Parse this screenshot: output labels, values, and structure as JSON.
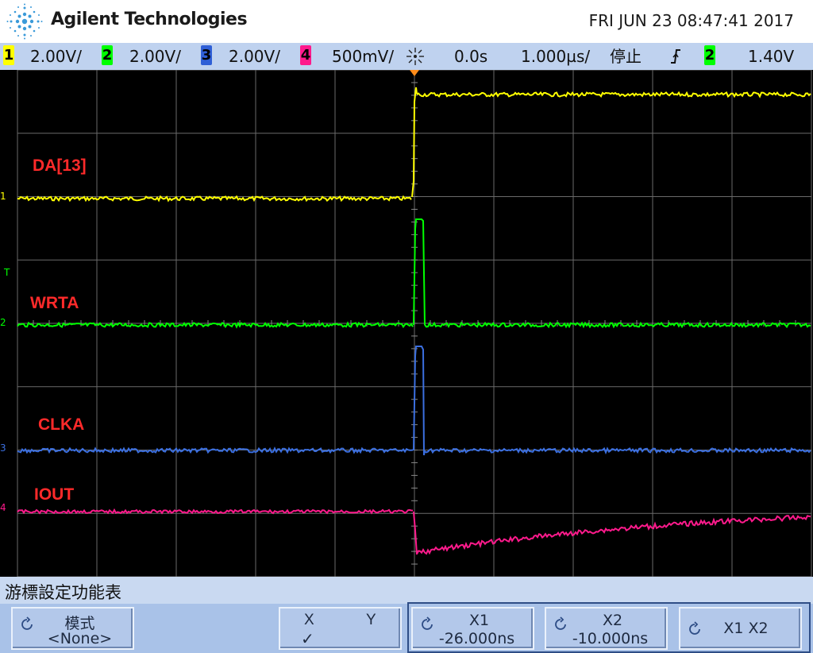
{
  "header": {
    "brand": "Agilent Technologies",
    "datetime": "FRI JUN 23 08:47:41 2017"
  },
  "statusbar": {
    "ch1": {
      "num": "1",
      "scale": "2.00V/",
      "color": "#ffff00"
    },
    "ch2": {
      "num": "2",
      "scale": "2.00V/",
      "color": "#00ff00"
    },
    "ch3": {
      "num": "3",
      "scale": "2.00V/",
      "color": "#3b6fe0"
    },
    "ch4": {
      "num": "4",
      "scale": "500mV/",
      "color": "#ff1a8c"
    },
    "delay": "0.0s",
    "timebase": "1.000µs/",
    "run_state": "停止",
    "trigger_edge": "rising-edge-icon",
    "trigger_source": "2",
    "trigger_level": "1.40V"
  },
  "screen": {
    "labels": {
      "ch1": "DA[13]",
      "ch2": "WRTA",
      "ch3": "CLKA",
      "ch4": "IOUT"
    },
    "markers": {
      "ch1": "1",
      "ch2": "2",
      "ch3": "3",
      "ch4": "4",
      "trigger": "T"
    }
  },
  "softkeys": {
    "menu_title": "游標設定功能表",
    "mode": {
      "line1": "模式",
      "line2": "<None>"
    },
    "xy": {
      "x": "X",
      "y": "Y",
      "check": "✓"
    },
    "x1": {
      "line1": "X1",
      "line2": "-26.000ns"
    },
    "x2": {
      "line1": "X2",
      "line2": "-10.000ns"
    },
    "x1x2": {
      "line1": "X1 X2"
    }
  }
}
